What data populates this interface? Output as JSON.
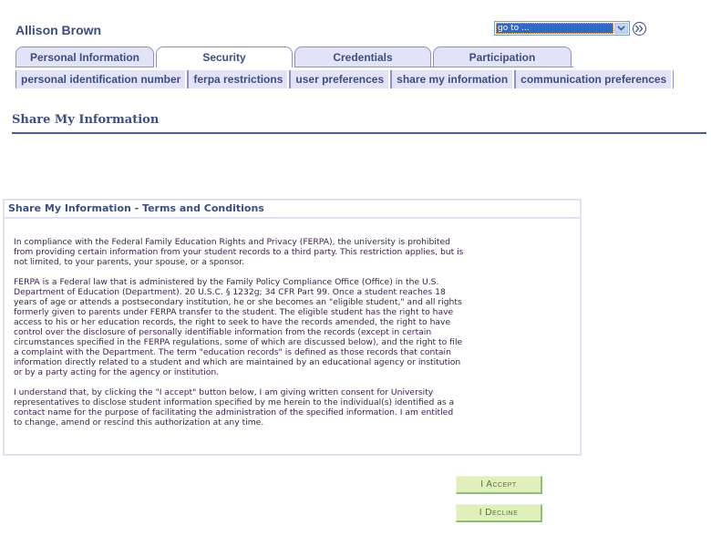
{
  "header": {
    "student_name": "Allison Brown",
    "goto": {
      "selected": "go to ...",
      "go_button_icon": "double-chevron-right-icon"
    }
  },
  "tabs": [
    {
      "label": "Personal Information",
      "active": false
    },
    {
      "label": "Security",
      "active": true
    },
    {
      "label": "Credentials",
      "active": false
    },
    {
      "label": "Participation",
      "active": false
    }
  ],
  "subtabs": [
    {
      "label": "personal identification number"
    },
    {
      "label": "ferpa restrictions"
    },
    {
      "label": "user preferences"
    },
    {
      "label": "share my information",
      "active": true
    },
    {
      "label": "communication preferences"
    }
  ],
  "page": {
    "title": "Share My Information"
  },
  "terms": {
    "header": "Share My Information - Terms and Conditions",
    "paragraphs": [
      [
        "In compliance with the Federal Family Education Rights and Privacy (FERPA), the university is prohibited",
        "from providing certain information from your student records to a third party. This restriction applies, but is",
        "not limited, to your parents, your spouse, or a sponsor."
      ],
      [
        "FERPA is a Federal law that is administered by the Family Policy Compliance Office (Office) in the U.S.",
        "Department of Education (Department). 20 U.S.C. § 1232g; 34 CFR Part 99. Once a student reaches 18",
        "years of age or attends a postsecondary institution, he or she becomes an \"eligible student,\" and all rights",
        "formerly given to parents under FERPA transfer to the student. The eligible student has the right to have",
        "access to his or her education records, the right to seek to have the records amended, the right to have",
        "control over the disclosure of personally identifiable information from the records (except in certain",
        "circumstances specified in the FERPA regulations, some of which are discussed below), and the right to file",
        "a complaint with the Department. The term \"education records\" is defined as those records that contain",
        "information directly related to a student and which are maintained by an educational agency or institution",
        "or by a party acting for the agency or institution."
      ],
      [
        "I understand that, by clicking the \"I accept\" button below, I am giving written consent for University",
        "representatives to disclose student information specified by me herein to the individual(s) identified as a",
        "contact name for the purpose of facilitating the administration of the specified information. I am entitled",
        "to change, amend or rescind this authorization at any time."
      ]
    ]
  },
  "buttons": {
    "accept": "I Accept",
    "decline": "I Decline"
  },
  "colors": {
    "brand_text": "#3c4e82",
    "tab_bg": "#e3e3f7",
    "button_bg": "#e1efbc",
    "button_text": "#52763b"
  }
}
